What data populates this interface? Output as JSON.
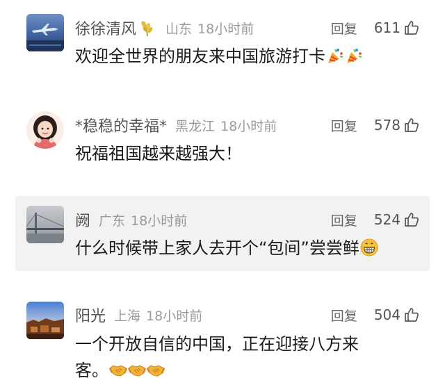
{
  "comments": [
    {
      "username": "徐徐清风",
      "badge": "wheat-icon",
      "location": "山东",
      "time": "18小时前",
      "reply_label": "回复",
      "likes": "611",
      "text": "欢迎全世界的朋友来中国旅游打卡",
      "emojis": [
        "party-popper-icon",
        "party-popper-icon"
      ]
    },
    {
      "username": "*稳稳的幸福*",
      "location": "黑龙江",
      "time": "18小时前",
      "reply_label": "回复",
      "likes": "578",
      "text": "祝福祖国越来越强大！"
    },
    {
      "username": "阙",
      "location": "广东",
      "time": "18小时前",
      "reply_label": "回复",
      "likes": "524",
      "text": "什么时候带上家人去开个“包间”尝尝鲜",
      "emojis": [
        "grinning-face-icon"
      ]
    },
    {
      "username": "阳光",
      "location": "上海",
      "time": "18小时前",
      "reply_label": "回复",
      "likes": "504",
      "text_line1": "一个开放自信的中国，正在迎接八方来",
      "text_line2": "客。",
      "emojis": [
        "handshake-icon",
        "handshake-icon",
        "handshake-icon"
      ]
    }
  ],
  "colors": {
    "username": "#555555",
    "meta": "#9a9a9a",
    "highlight_bg": "#f2f2f2",
    "text": "#1a1a1a"
  }
}
